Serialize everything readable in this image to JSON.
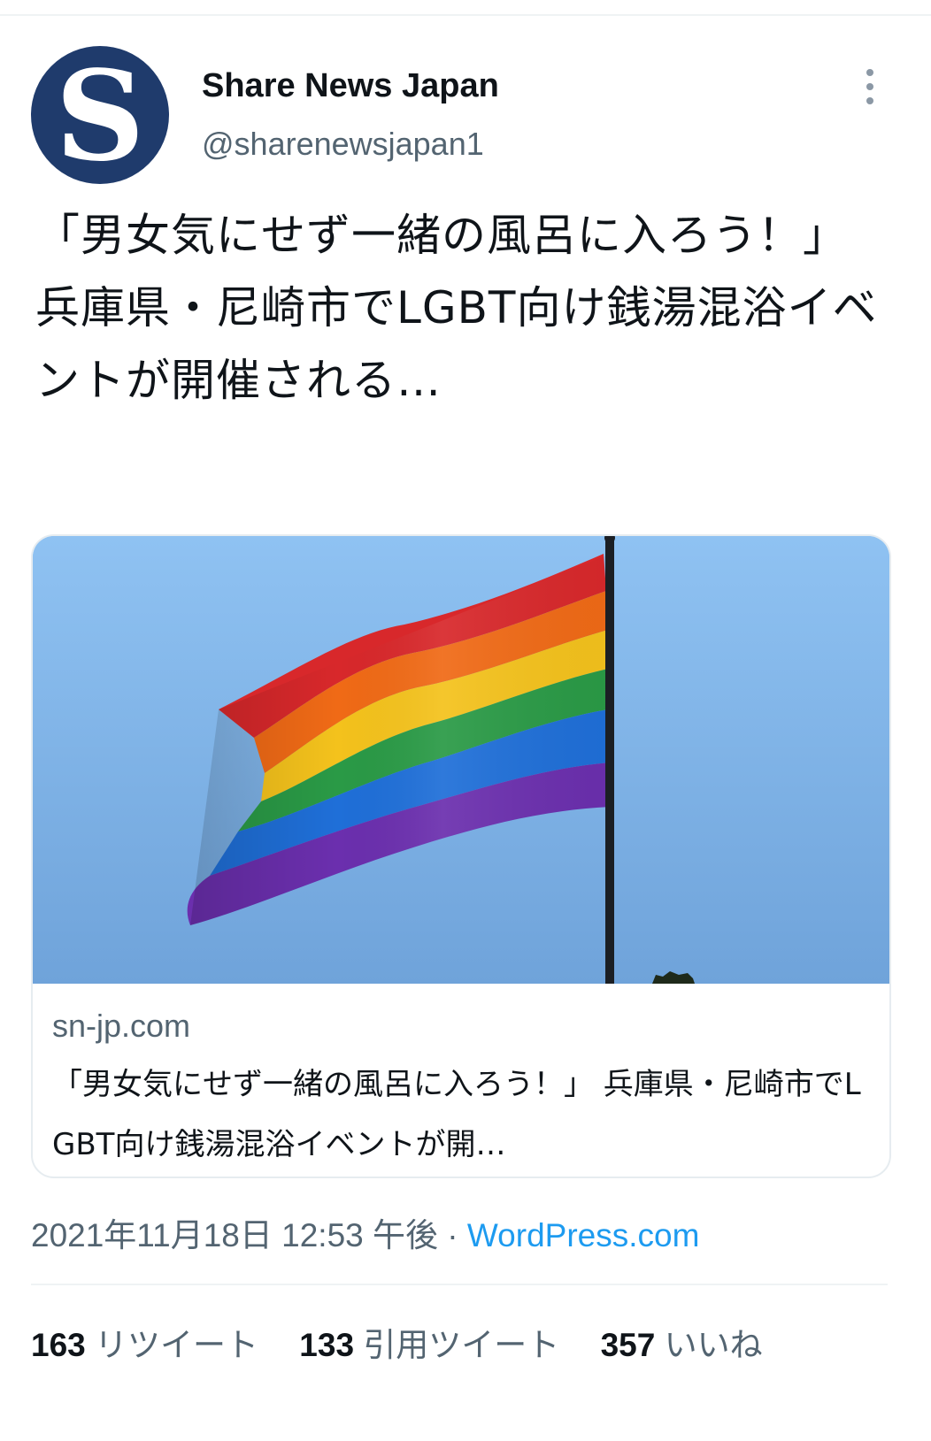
{
  "tweet": {
    "author": {
      "avatar_letter": "S",
      "avatar_color": "#1f3b6c",
      "display_name": "Share News Japan",
      "handle": "@sharenewsjapan1"
    },
    "more_icon": "more-vertical-icon",
    "text": "「男女気にせず一緒の風呂に入ろう！」 兵庫県・尼崎市でLGBT向け銭湯混浴イベントが開催される…",
    "card": {
      "image_description_icon": "rainbow-flag-image",
      "domain": "sn-jp.com",
      "title": "「男女気にせず一緒の風呂に入ろう！」 兵庫県・尼崎市でLGBT向け銭湯混浴イベントが開…"
    },
    "timestamp": "2021年11月18日 12:53 午後",
    "separator": " · ",
    "source": "WordPress.com",
    "stats": {
      "retweets_count": "163",
      "retweets_label": "リツイート",
      "quotes_count": "133",
      "quotes_label": "引用ツイート",
      "likes_count": "357",
      "likes_label": "いいね"
    }
  },
  "colors": {
    "text_primary": "#0f1419",
    "text_secondary": "#536471",
    "link": "#1d9bf0",
    "divider": "#eff3f4"
  }
}
